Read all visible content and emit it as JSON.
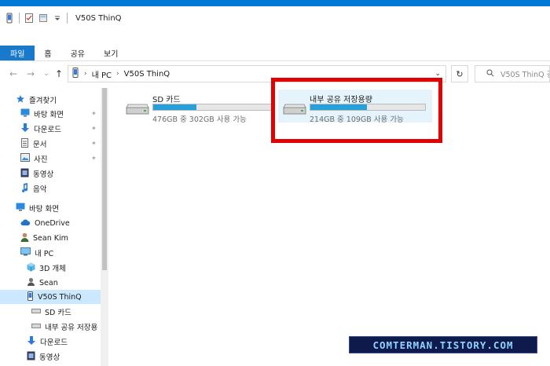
{
  "window": {
    "title": "V50S ThinQ"
  },
  "ribbon": {
    "tabs": [
      "파일",
      "홈",
      "공유",
      "보기"
    ]
  },
  "address": {
    "device_name": "내 PC",
    "current": "V50S ThinQ",
    "search_placeholder": "V50S ThinQ 검"
  },
  "sidebar": {
    "items": [
      {
        "label": "즐겨찾기",
        "icon": "star-icon"
      },
      {
        "label": "바탕 화면",
        "icon": "desktop-icon",
        "pinned": true
      },
      {
        "label": "다운로드",
        "icon": "download-icon",
        "pinned": true
      },
      {
        "label": "문서",
        "icon": "document-icon",
        "pinned": true
      },
      {
        "label": "사진",
        "icon": "pictures-icon",
        "pinned": true
      },
      {
        "label": "동영상",
        "icon": "video-icon"
      },
      {
        "label": "음악",
        "icon": "music-icon"
      },
      {
        "label": "바탕 화면",
        "icon": "desktop-icon"
      },
      {
        "label": "OneDrive",
        "icon": "cloud-icon"
      },
      {
        "label": "Sean Kim",
        "icon": "user-icon"
      },
      {
        "label": "내 PC",
        "icon": "computer-icon"
      },
      {
        "label": "3D 개체",
        "icon": "cube-icon"
      },
      {
        "label": "Sean",
        "icon": "network-user-icon"
      },
      {
        "label": "V50S ThinQ",
        "icon": "phone-icon",
        "selected": true
      },
      {
        "label": "SD 카드",
        "icon": "drive-icon"
      },
      {
        "label": "내부 공유 저장용",
        "icon": "drive-icon"
      },
      {
        "label": "다운로드",
        "icon": "download-icon"
      },
      {
        "label": "동영상",
        "icon": "video-icon"
      }
    ]
  },
  "drives": [
    {
      "name": "SD 카드",
      "detail": "476GB 중 302GB 사용 가능",
      "used_fraction": 0.366
    },
    {
      "name": "내부 공유 저장용량",
      "detail": "214GB 중 109GB 사용 가능",
      "used_fraction": 0.491,
      "selected": true
    }
  ],
  "watermark": "COMTERMAN.TISTORY.COM",
  "colors": {
    "accent": "#0078d7",
    "file_tab": "#1979ca",
    "progress": "#26a0da",
    "selection": "#cce8ff",
    "highlight_box": "#e20000"
  }
}
